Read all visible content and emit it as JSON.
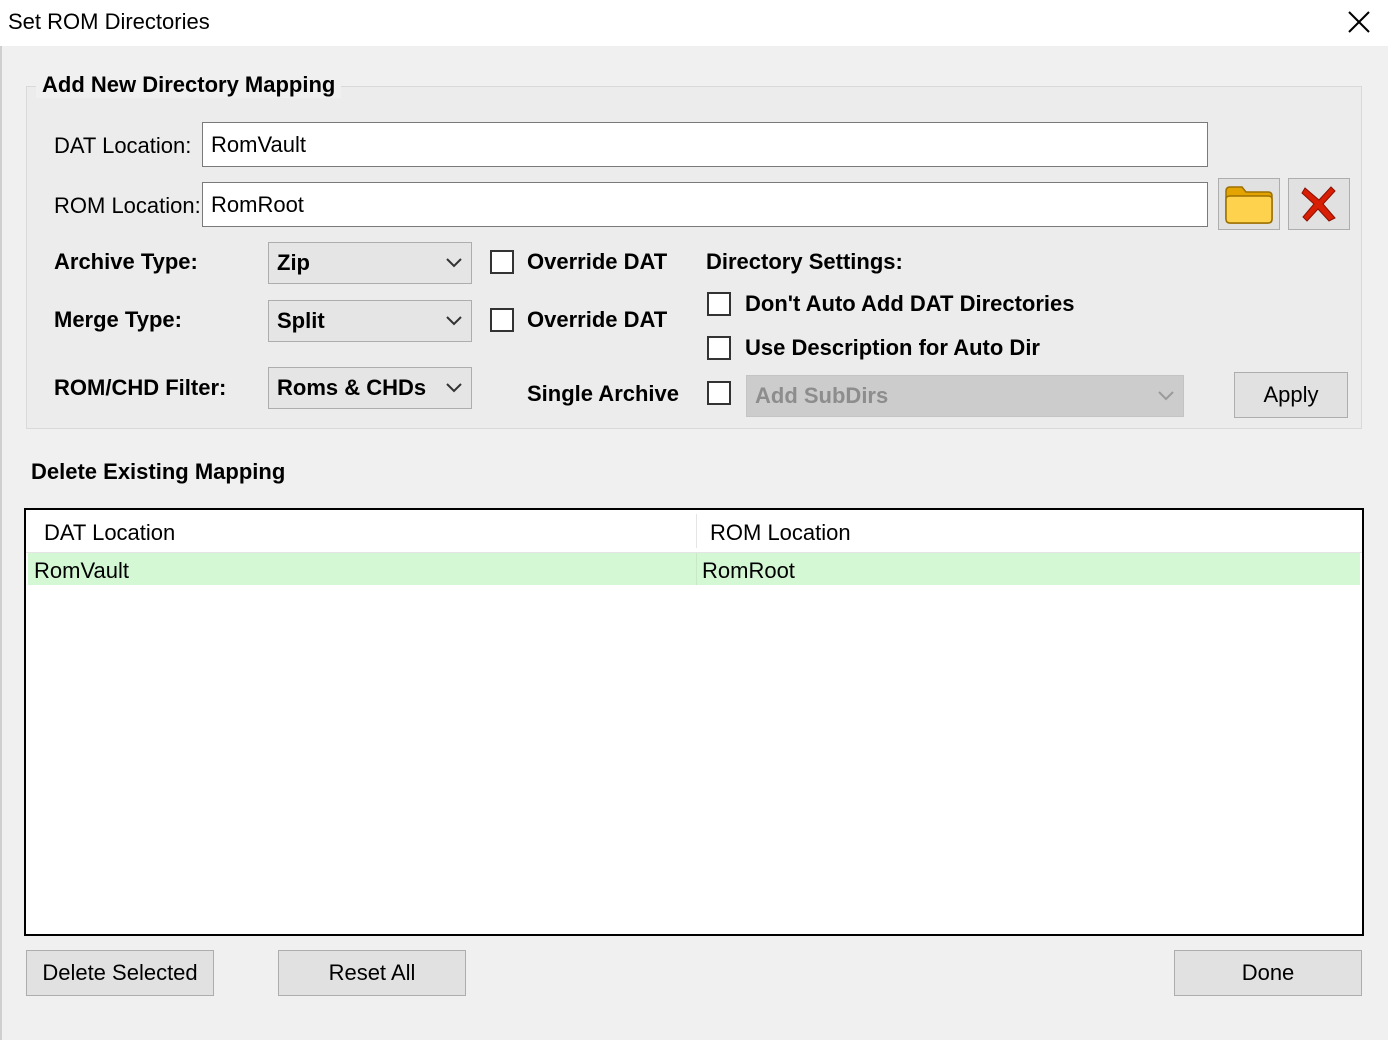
{
  "window": {
    "title": "Set ROM Directories",
    "close_glyph": "✕"
  },
  "add_group": {
    "title": "Add New Directory Mapping",
    "dat_location_label": "DAT Location:",
    "dat_location_value": "RomVault",
    "rom_location_label": "ROM Location:",
    "rom_location_value": "RomRoot",
    "archive_type_label": "Archive Type:",
    "archive_type_value": "Zip",
    "merge_type_label": "Merge Type:",
    "merge_type_value": "Split",
    "filter_label": "ROM/CHD Filter:",
    "filter_value": "Roms & CHDs",
    "override_dat_1": "Override DAT",
    "override_dat_2": "Override DAT",
    "single_archive_label": "Single Archive",
    "subdirs_value": "Add SubDirs",
    "directory_settings_label": "Directory Settings:",
    "dont_auto_add_label": "Don't Auto Add DAT Directories",
    "use_description_label": "Use Description for Auto Dir",
    "apply_label": "Apply",
    "folder_icon": "folder-icon",
    "clear_icon": "red-x-icon"
  },
  "delete_section": {
    "title": "Delete Existing Mapping",
    "columns": [
      "DAT Location",
      "ROM Location"
    ],
    "rows": [
      {
        "dat": "RomVault",
        "rom": "RomRoot"
      }
    ]
  },
  "buttons": {
    "delete_selected": "Delete Selected",
    "reset_all": "Reset All",
    "done": "Done"
  },
  "colors": {
    "selected_row": "#d4f7d4",
    "close_x": "#000000",
    "folder": "#f5b800",
    "red_x": "#d81e05"
  }
}
